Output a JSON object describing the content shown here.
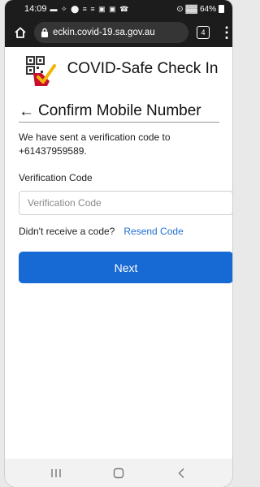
{
  "status_bar": {
    "time": "14:09",
    "notification_icons": "▬ ✧ ⬤ ≡ ≡ ▣ ▣ ☎",
    "signal_text": "⊙ ▓▓",
    "battery": "64%"
  },
  "browser": {
    "url": "eckin.covid-19.sa.gov.au",
    "tab_count": "4",
    "menu_label": "⋮"
  },
  "header": {
    "title": "COVID-Safe Check In"
  },
  "page": {
    "back_arrow": "←",
    "title": "Confirm Mobile Number",
    "message": "We have sent a verification code to +61437959589.",
    "code_label": "Verification Code",
    "code_placeholder": "Verification Code",
    "code_value": "",
    "resend_prompt": "Didn't receive a code?",
    "resend_link": "Resend Code",
    "next_button": "Next"
  },
  "navbar": {
    "recent": "recent-apps",
    "home": "home",
    "back": "back"
  },
  "colors": {
    "primary": "#1769d4",
    "link": "#1f6fd1",
    "logo_red": "#c8102e",
    "logo_gold": "#f2b705"
  }
}
